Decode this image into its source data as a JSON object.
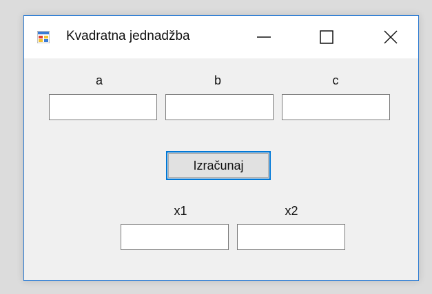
{
  "window": {
    "title": "Kvadratna jednadžba",
    "controls": {
      "minimize_icon": "minimize-icon",
      "maximize_icon": "maximize-icon",
      "close_icon": "close-icon"
    },
    "accent_color": "#0078d7"
  },
  "inputs": {
    "a": {
      "label": "a",
      "value": ""
    },
    "b": {
      "label": "b",
      "value": ""
    },
    "c": {
      "label": "c",
      "value": ""
    }
  },
  "calculate_button": {
    "label": "Izračunaj"
  },
  "outputs": {
    "x1": {
      "label": "x1",
      "value": ""
    },
    "x2": {
      "label": "x2",
      "value": ""
    }
  }
}
